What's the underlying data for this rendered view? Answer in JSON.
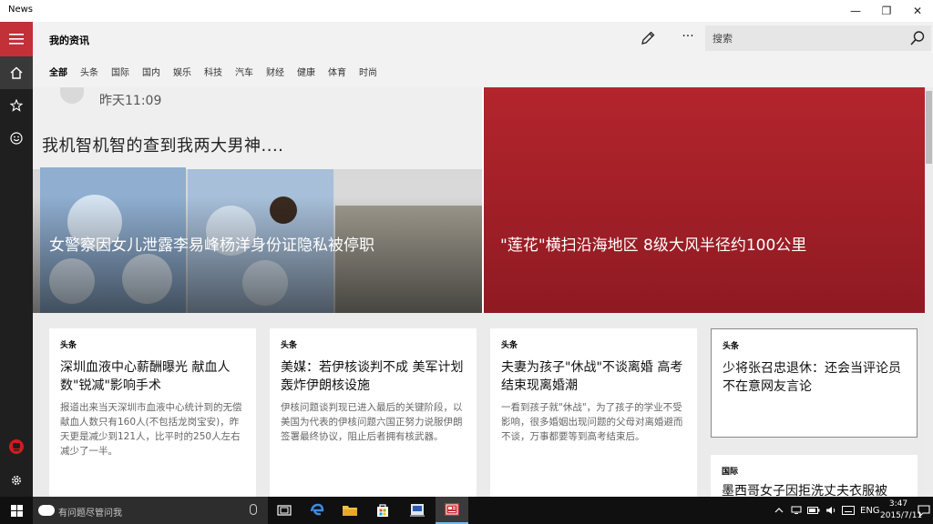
{
  "window": {
    "title": "News",
    "minimize": "—",
    "restore": "❐",
    "close": "✕"
  },
  "header": {
    "page_title": "我的资讯",
    "more": "···",
    "search_placeholder": "搜索"
  },
  "tabs": [
    {
      "label": "全部",
      "active": true
    },
    {
      "label": "头条"
    },
    {
      "label": "国际"
    },
    {
      "label": "国内"
    },
    {
      "label": "娱乐"
    },
    {
      "label": "科技"
    },
    {
      "label": "汽车"
    },
    {
      "label": "财经"
    },
    {
      "label": "健康"
    },
    {
      "label": "体育"
    },
    {
      "label": "时尚"
    }
  ],
  "hero": {
    "left": {
      "image_time_text": "昨天11:09",
      "image_caption_text": "我机智机智的查到我两大男神....",
      "title": "女警察因女儿泄露李易峰杨洋身份证隐私被停职"
    },
    "right": {
      "title": "\"莲花\"横扫沿海地区 8级大风半径约100公里",
      "color": "#b4252d"
    }
  },
  "cards": [
    {
      "tag": "头条",
      "title": "深圳血液中心薪酬曝光 献血人数\"锐减\"影响手术",
      "desc": "报道出来当天深圳市血液中心统计到的无偿献血人数只有160人(不包括龙岗宝安)，昨天更是减少到121人，比平时的250人左右减少了一半。"
    },
    {
      "tag": "头条",
      "title": "美媒：若伊核谈判不成 美军计划轰炸伊朗核设施",
      "desc": "伊核问题谈判现已进入最后的关键阶段，以美国为代表的伊核问题六国正努力说服伊朗签署最终协议，阻止后者拥有核武器。"
    },
    {
      "tag": "头条",
      "title": "夫妻为孩子\"休战\"不谈离婚 高考结束现离婚潮",
      "desc": "一看到孩子就\"休战\"，为了孩子的学业不受影响，很多婚姻出现问题的父母对离婚避而不谈，万事都要等到高考结束后。"
    },
    {
      "tag": "头条",
      "title": "少将张召忠退休：还会当评论员 不在意网友言论",
      "desc": ""
    },
    {
      "tag": "国际",
      "title": "墨西哥女子因拒洗丈夫衣服被",
      "desc": ""
    }
  ],
  "taskbar": {
    "search_placeholder": "有问题尽管问我",
    "language": "ENG",
    "time": "3:47",
    "date": "2015/7/11"
  },
  "colors": {
    "accent": "#c23038",
    "rail": "#1f1f1f",
    "header_bg": "#f2f2f2",
    "taskbar": "#101010"
  },
  "icons": {
    "rail": [
      "hamburger-menu-icon",
      "home-icon",
      "favorites-star-icon",
      "interests-smiley-icon",
      "local-news-icon",
      "settings-gear-icon"
    ],
    "header": [
      "edit-pencil-icon",
      "more-ellipsis-icon",
      "search-icon"
    ],
    "taskbar": [
      "windows-start-icon",
      "cortana-icon",
      "microphone-icon",
      "task-view-icon",
      "edge-icon",
      "file-explorer-icon",
      "store-icon",
      "app-icon",
      "news-app-icon"
    ]
  }
}
